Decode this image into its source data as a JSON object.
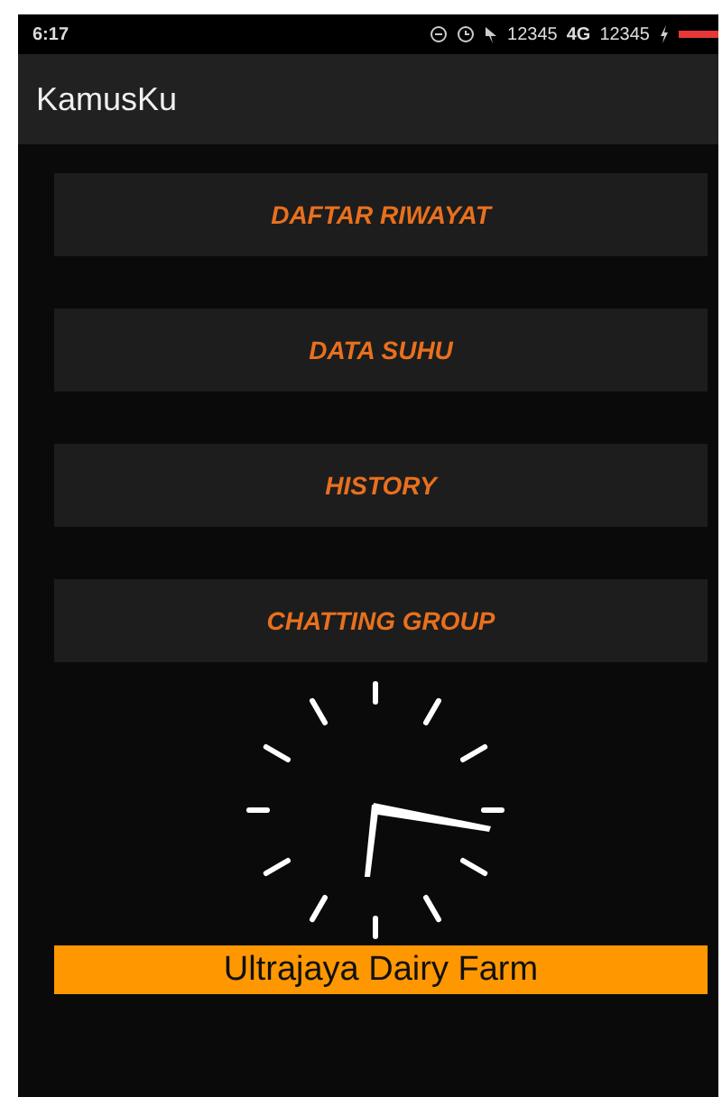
{
  "status_bar": {
    "time": "6:17",
    "signal_1": "12345",
    "network": "4G",
    "signal_2": "12345"
  },
  "app_bar": {
    "title": "KamusKu"
  },
  "menu_buttons": [
    {
      "label": "DAFTAR RIWAYAT"
    },
    {
      "label": "DATA SUHU"
    },
    {
      "label": "HISTORY"
    },
    {
      "label": "CHATTING GROUP"
    }
  ],
  "banner": {
    "text": "Ultrajaya Dairy Farm"
  }
}
